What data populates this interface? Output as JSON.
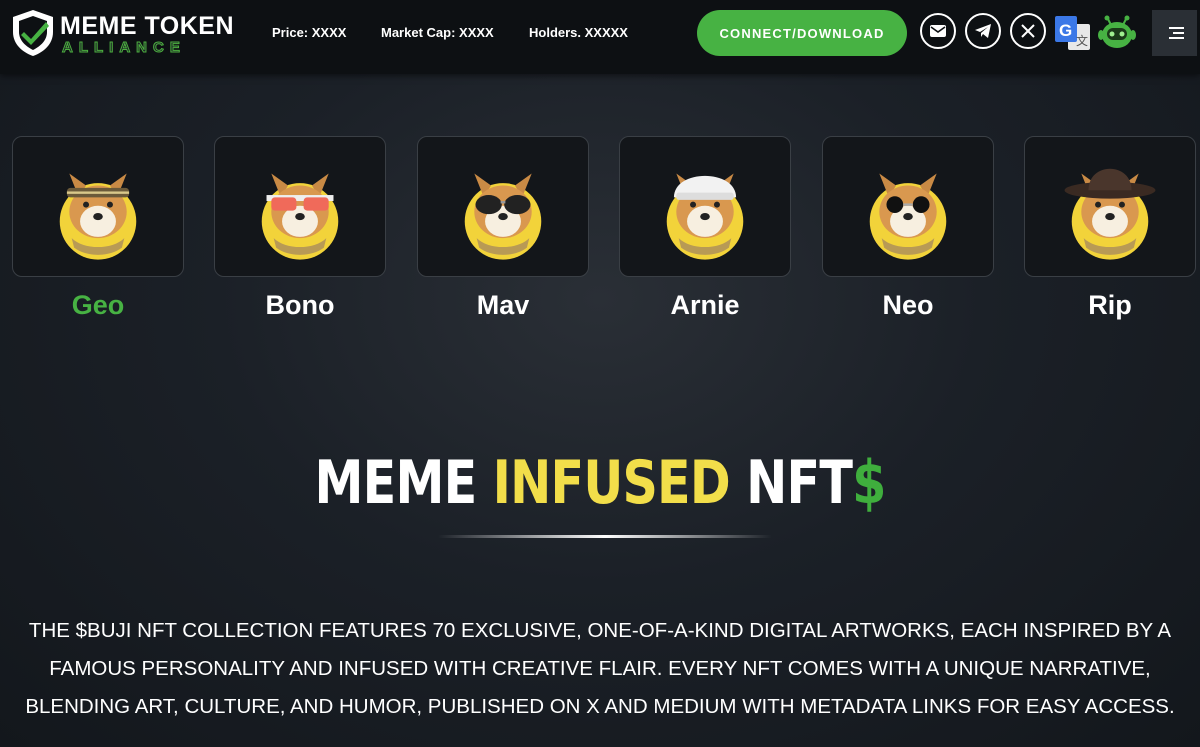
{
  "header": {
    "logo_line1": "MEME TOKEN",
    "logo_line2": "ALLIANCE",
    "price": "Price: XXXX",
    "market_cap": "Market Cap: XXXX",
    "holders": "Holders. XXXXX",
    "connect_label": "CONNECT/DOWNLOAD",
    "icons": [
      "mail-icon",
      "telegram-icon",
      "x-icon",
      "translate-icon",
      "bot-icon",
      "hamburger-menu-icon"
    ]
  },
  "nfts": [
    {
      "name": "Geo",
      "active": true,
      "accessory": "headband"
    },
    {
      "name": "Bono",
      "active": false,
      "accessory": "red-sunglasses"
    },
    {
      "name": "Mav",
      "active": false,
      "accessory": "aviator-sunglasses"
    },
    {
      "name": "Arnie",
      "active": false,
      "accessory": "white-cap"
    },
    {
      "name": "Neo",
      "active": false,
      "accessory": "round-sunglasses"
    },
    {
      "name": "Rip",
      "active": false,
      "accessory": "cowboy-hat"
    }
  ],
  "headline": {
    "part1": "MEME ",
    "part2": "INFUSED",
    "part3": " NFT",
    "part4": "$"
  },
  "description": "THE $BUJI NFT COLLECTION FEATURES 70 EXCLUSIVE, ONE-OF-A-KIND DIGITAL ARTWORKS, EACH INSPIRED BY A FAMOUS PERSONALITY AND INFUSED WITH CREATIVE FLAIR. EVERY NFT COMES WITH A UNIQUE NARRATIVE, BLENDING ART, CULTURE, AND HUMOR, PUBLISHED ON X AND MEDIUM WITH METADATA LINKS FOR EASY ACCESS.",
  "colors": {
    "accent_green": "#47b243",
    "accent_yellow": "#f2de4a",
    "header_bg": "#0d1013",
    "card_bg": "#13161a"
  }
}
